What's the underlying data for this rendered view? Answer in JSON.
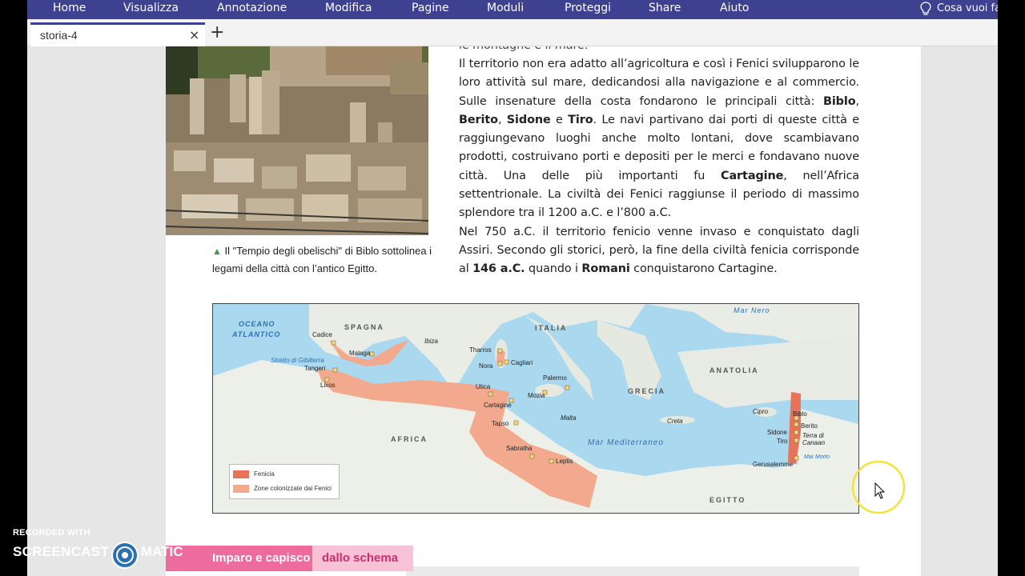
{
  "menu": {
    "items": [
      "Home",
      "Visualizza",
      "Annotazione",
      "Modifica",
      "Pagine",
      "Moduli",
      "Proteggi",
      "Share",
      "Aiuto"
    ],
    "tell_me": "Cosa vuoi fa"
  },
  "tabs": {
    "active_label": "storia-4",
    "close_symbol": "×",
    "new_tab_symbol": "+"
  },
  "page": {
    "text_top_fragment": "le montagne e il mare.",
    "paragraph1": {
      "a": "Il territorio non era adatto all’agricoltura e così i Fenici svilupparono le loro attività sul mare, dedicandosi alla navigazione e al commercio. Sulle insenature della costa fondarono le principali città: ",
      "biblo": "Biblo",
      "sep1": ", ",
      "berito": "Berito",
      "sep2": ", ",
      "sidone": "Sidone",
      "sep3": " e ",
      "tiro": "Tiro",
      "b": ". Le navi partivano dai porti di queste città e raggiungevano luoghi anche molto lontani, dove scambiavano prodotti, costruivano porti e depositi per le merci e fondavano nuove città. Una delle più importanti fu ",
      "cartagine": "Cartagine",
      "c": ", nell’Africa settentrionale. La civiltà dei Fenici raggiunse il periodo di massimo splendore tra il 1200 a.C. e l’800 a.C."
    },
    "paragraph2": {
      "a": "Nel 750 a.C. il territorio fenicio venne invaso e conquistato dagli Assiri. Secondo gli storici, però, la fine della civiltà fenicia corrisponde al ",
      "year": "146 a.C.",
      "b": " quando i ",
      "romani": "Romani",
      "c": " conquistarono Cartagine."
    },
    "caption": "Il \"Tempio degli obelischi\" di Biblo sottolinea i legami della città con l’antico Egitto.",
    "caption_marker": "▲"
  },
  "map": {
    "seas": {
      "oceano1": "OCEANO",
      "oceano2": "ATLANTICO",
      "mar_nero": "Mar Nero",
      "mediterraneo": "Mar   Mediterraneo",
      "stretto": "Stretto di Gibilterra",
      "mar_morto": "Mar Morto"
    },
    "regions": {
      "spagna": "SPAGNA",
      "italia": "ITALIA",
      "grecia": "GRECIA",
      "anatolia": "ANATOLIA",
      "africa": "AFRICA",
      "egitto": "EGITTO",
      "terra_canaan": "Terra di Canaan"
    },
    "cities": {
      "cadice": "Cadice",
      "malaga": "Malaga",
      "tangeri": "Tangeri",
      "lixos": "Lixos",
      "ibiza": "Ibiza",
      "tharros": "Tharros",
      "nora": "Nora",
      "cagliari": "Cagliari",
      "palermo": "Palermo",
      "mozia": "Mozia",
      "utica": "Utica",
      "cartagine": "Cartagine",
      "tapso": "Tapso",
      "malta": "Malta",
      "sabratha": "Sabratha",
      "leptis": "Leptis",
      "creta": "Creta",
      "cipro": "Cipro",
      "biblo": "Biblo",
      "berito": "Berito",
      "sidone": "Sidone",
      "tiro": "Tiro",
      "gerusalemme": "Gerusalemme"
    },
    "legend": {
      "fenicia": "Fenicia",
      "zone": "Zone colonizzate dai Fenici"
    },
    "colors": {
      "sea": "#a9d8ef",
      "land": "#e9ede5",
      "fenicia": "#e8735a",
      "colonie": "#f3a98d"
    }
  },
  "bottom": {
    "imparo": "Imparo e capisco",
    "dallo": "dallo schema"
  },
  "watermark": {
    "recorded": "RECORDED WITH",
    "screencast": "SCREENCAST",
    "matic": "MATIC"
  }
}
